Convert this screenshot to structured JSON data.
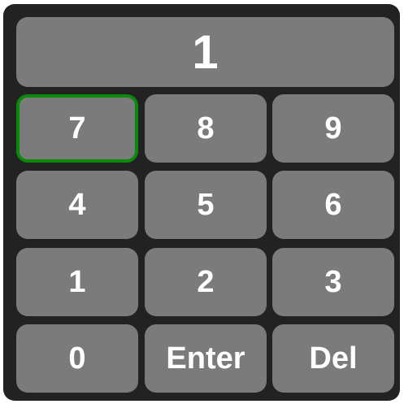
{
  "display": {
    "value": "1"
  },
  "keys": [
    {
      "label": "7",
      "focused": true
    },
    {
      "label": "8",
      "focused": false
    },
    {
      "label": "9",
      "focused": false
    },
    {
      "label": "4",
      "focused": false
    },
    {
      "label": "5",
      "focused": false
    },
    {
      "label": "6",
      "focused": false
    },
    {
      "label": "1",
      "focused": false
    },
    {
      "label": "2",
      "focused": false
    },
    {
      "label": "3",
      "focused": false
    },
    {
      "label": "0",
      "focused": false
    },
    {
      "label": "Enter",
      "focused": false
    },
    {
      "label": "Del",
      "focused": false
    }
  ],
  "colors": {
    "panel": "#222222",
    "key": "#7b7b7b",
    "text": "#ffffff",
    "focus": "#0a8a0a"
  }
}
